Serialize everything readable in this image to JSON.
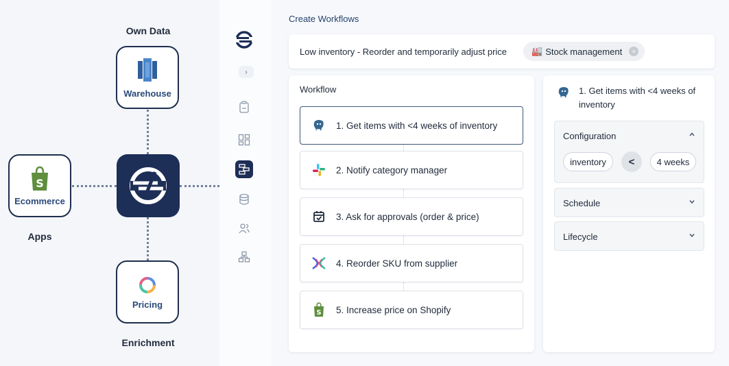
{
  "diagram": {
    "own_data_label": "Own Data",
    "warehouse_label": "Warehouse",
    "ecommerce_label": "Ecommerce",
    "apps_label": "Apps",
    "pricing_label": "Pricing",
    "enrichment_label": "Enrichment"
  },
  "sidebar": {
    "expand_glyph": "›",
    "items": [
      "clipboard-icon",
      "dashboard-icon",
      "workflow-icon",
      "database-icon",
      "users-icon",
      "integrations-icon"
    ],
    "active_item": "workflow-icon"
  },
  "page": {
    "title": "Create Workflows"
  },
  "topbar": {
    "workflow_name": "Low inventory - Reorder and temporarily adjust price",
    "tag_emoji": "🏭",
    "tag_label": "Stock management",
    "tag_close": "×"
  },
  "workflow": {
    "title": "Workflow",
    "steps": [
      {
        "label": "1. Get items with <4 weeks of inventory",
        "icon": "postgres-icon",
        "selected": true
      },
      {
        "label": "2. Notify category manager",
        "icon": "slack-icon"
      },
      {
        "label": "3. Ask for approvals (order & price)",
        "icon": "calendar-check-icon"
      },
      {
        "label": "4. Reorder SKU from supplier",
        "icon": "supplier-icon"
      },
      {
        "label": "5. Increase price on Shopify",
        "icon": "shopify-icon"
      }
    ]
  },
  "detail": {
    "title": "1. Get items with <4 weeks of inventory",
    "configuration": {
      "label": "Configuration",
      "field": "inventory",
      "operator": "<",
      "value": "4 weeks"
    },
    "schedule_label": "Schedule",
    "lifecycle_label": "Lifecycle"
  },
  "colors": {
    "brand_navy": "#1d2e57",
    "shopify_green": "#5e8e3e",
    "link_blue": "#27426e"
  }
}
